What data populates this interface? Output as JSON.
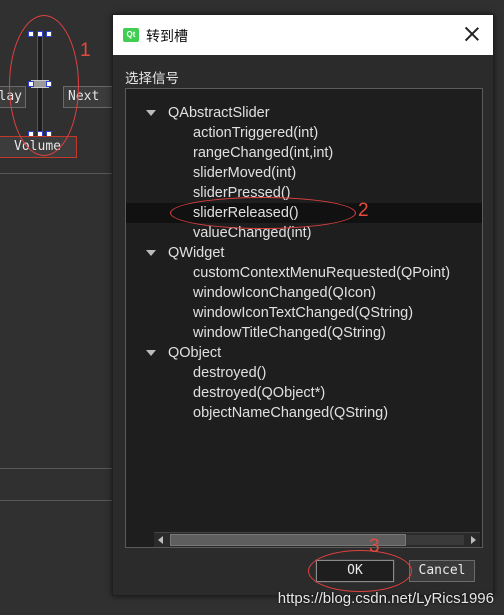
{
  "background": {
    "buttons": {
      "play": "Play",
      "next": "Next",
      "volume": "Volume"
    }
  },
  "annotations": {
    "one": "1",
    "two": "2",
    "three": "3"
  },
  "dialog": {
    "title": "转到槽",
    "section_label": "选择信号",
    "app_icon_label": "Qt",
    "groups": [
      {
        "name": "QAbstractSlider",
        "items": [
          "actionTriggered(int)",
          "rangeChanged(int,int)",
          "sliderMoved(int)",
          "sliderPressed()",
          "sliderReleased()",
          "valueChanged(int)"
        ]
      },
      {
        "name": "QWidget",
        "items": [
          "customContextMenuRequested(QPoint)",
          "windowIconChanged(QIcon)",
          "windowIconTextChanged(QString)",
          "windowTitleChanged(QString)"
        ]
      },
      {
        "name": "QObject",
        "items": [
          "destroyed()",
          "destroyed(QObject*)",
          "objectNameChanged(QString)"
        ]
      }
    ],
    "selected_item": "sliderReleased()",
    "ok_label": "OK",
    "cancel_label": "Cancel"
  },
  "watermark": "https://blog.csdn.net/LyRics1996",
  "colors": {
    "annotation": "#e64a3c",
    "tree_bg": "#1e1e1e",
    "dialog_bg": "#2b2b2b",
    "qt_green": "#41cd52"
  }
}
